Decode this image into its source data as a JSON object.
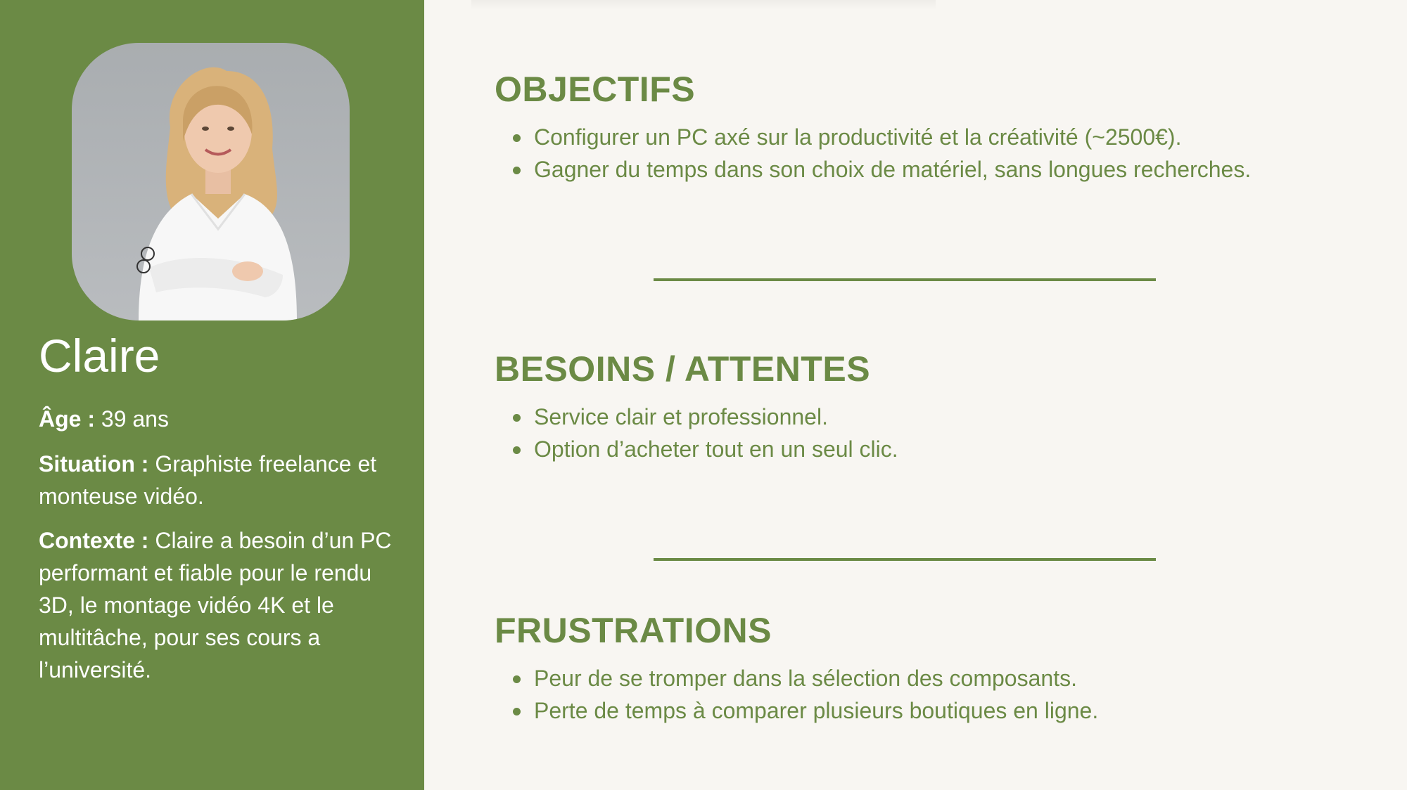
{
  "persona": {
    "name": "Claire",
    "photo_icon": "persona-photo",
    "age_label": "Âge :",
    "age_value": "39 ans",
    "situation_label": "Situation :",
    "situation_value": "Graphiste freelance et monteuse vidéo.",
    "context_label": "Contexte :",
    "context_value": "Claire a besoin d’un PC performant et fiable pour le rendu 3D, le montage vidéo 4K et le multitâche, pour ses cours a l’université."
  },
  "sections": {
    "objectifs": {
      "title": "OBJECTIFS",
      "items": [
        "Configurer un PC axé sur la productivité et la créativité (~2500€).",
        "Gagner du temps dans son choix de matériel, sans longues recherches."
      ]
    },
    "besoins": {
      "title": "BESOINS / ATTENTES",
      "items": [
        "Service clair et professionnel.",
        "Option d’acheter tout en un seul clic."
      ]
    },
    "frustrations": {
      "title": "FRUSTRATIONS",
      "items": [
        "Peur de se tromper dans la sélection des composants.",
        "Perte de temps à comparer plusieurs boutiques en ligne."
      ]
    }
  },
  "colors": {
    "accent": "#6b8a45",
    "background": "#f8f6f2",
    "sidebar_text": "#ffffff"
  }
}
